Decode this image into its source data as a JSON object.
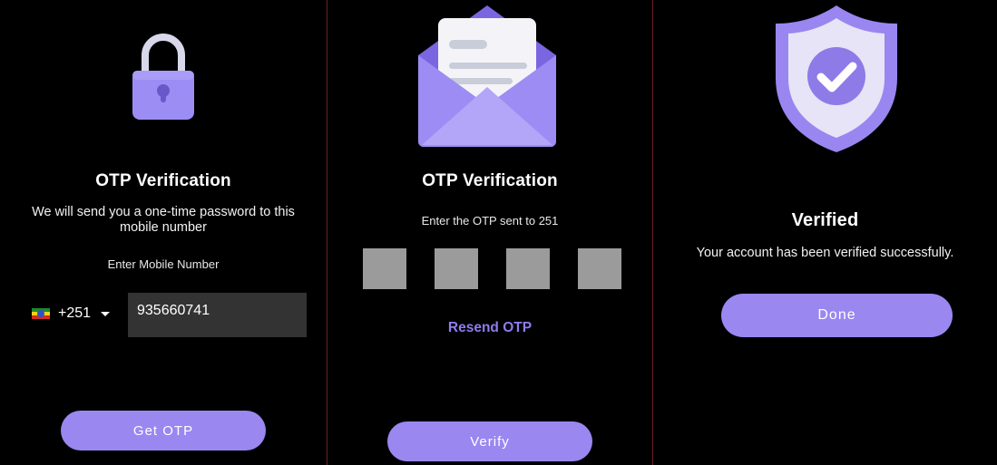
{
  "screen1": {
    "title": "OTP Verification",
    "description": "We will send you a one-time password to this mobile number",
    "phone_label": "Enter Mobile Number",
    "country_code": "+251",
    "phone_value": "935660741",
    "button_label": "Get OTP",
    "icon": "lock-icon"
  },
  "screen2": {
    "title": "OTP Verification",
    "description": "Enter the OTP sent to 251",
    "otp_digits": [
      "",
      "",
      "",
      ""
    ],
    "resend_label": "Resend OTP",
    "button_label": "Verify",
    "icon": "envelope-icon"
  },
  "screen3": {
    "title": "Verified",
    "description": "Your account has been verified successfully.",
    "button_label": "Done",
    "icon": "shield-check-icon"
  },
  "colors": {
    "accent": "#9a87f0",
    "accent_text": "#8f7cf0",
    "background": "#000000",
    "input_bg": "#333333",
    "otp_box": "#9b9b9b",
    "divider": "#6b1e25"
  }
}
